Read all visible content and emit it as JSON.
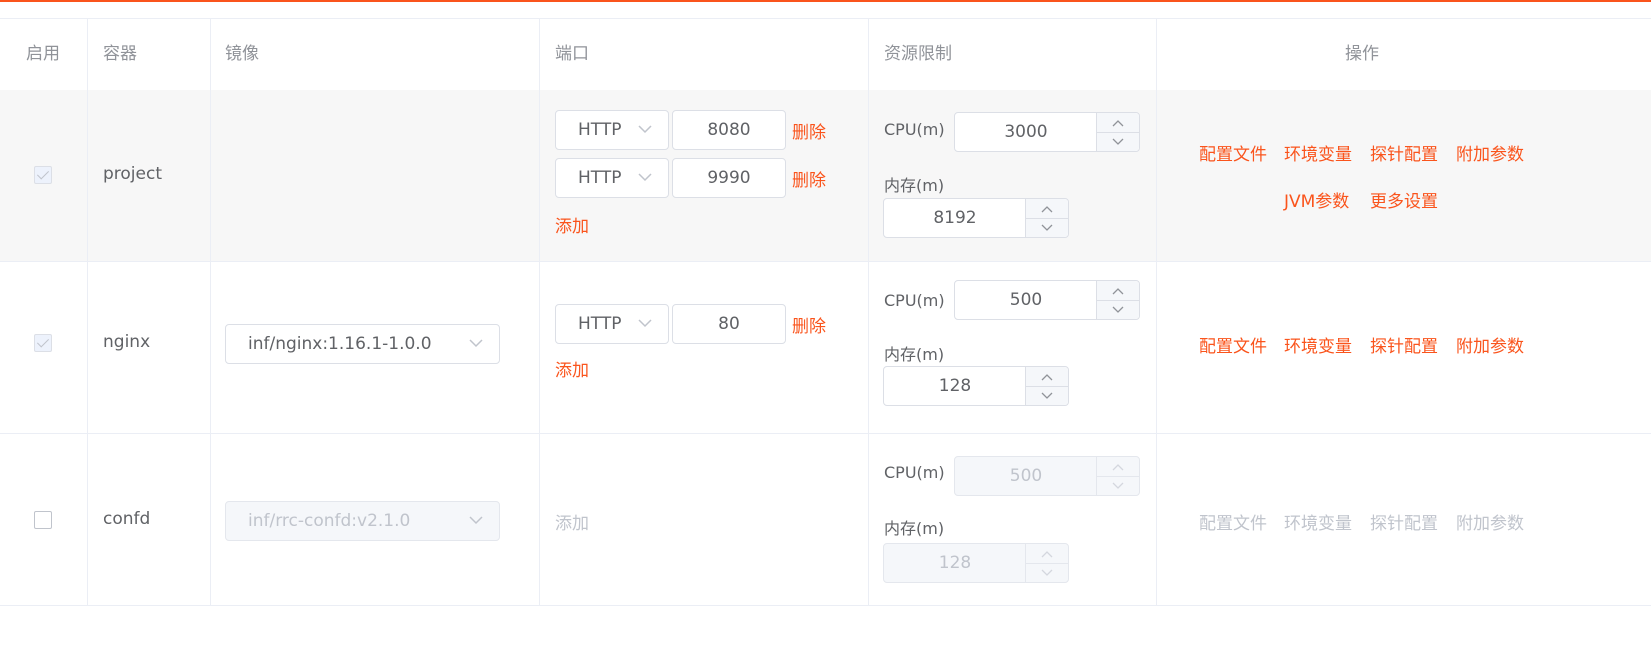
{
  "columns": {
    "enable": "启用",
    "container": "容器",
    "image": "镜像",
    "port": "端口",
    "resource": "资源限制",
    "action": "操作"
  },
  "labels": {
    "cpu": "CPU(m)",
    "memory": "内存(m)",
    "delete": "删除",
    "add": "添加"
  },
  "rows": [
    {
      "name": "project",
      "enabled": true,
      "image": "",
      "ports": [
        {
          "protocol": "HTTP",
          "port": "8080"
        },
        {
          "protocol": "HTTP",
          "port": "9990"
        }
      ],
      "cpu": "3000",
      "memory": "8192",
      "actions": [
        "配置文件",
        "环境变量",
        "探针配置",
        "附加参数",
        "JVM参数",
        "更多设置"
      ]
    },
    {
      "name": "nginx",
      "enabled": true,
      "image": "inf/nginx:1.16.1-1.0.0",
      "ports": [
        {
          "protocol": "HTTP",
          "port": "80"
        }
      ],
      "cpu": "500",
      "memory": "128",
      "actions": [
        "配置文件",
        "环境变量",
        "探针配置",
        "附加参数"
      ]
    },
    {
      "name": "confd",
      "enabled": false,
      "image": "inf/rrc-confd:v2.1.0",
      "ports": [],
      "cpu": "500",
      "memory": "128",
      "actions": [
        "配置文件",
        "环境变量",
        "探针配置",
        "附加参数"
      ]
    }
  ],
  "colors": {
    "accent": "#fa541c",
    "disabled": "#c0c4cc",
    "border": "#dcdfe6"
  }
}
